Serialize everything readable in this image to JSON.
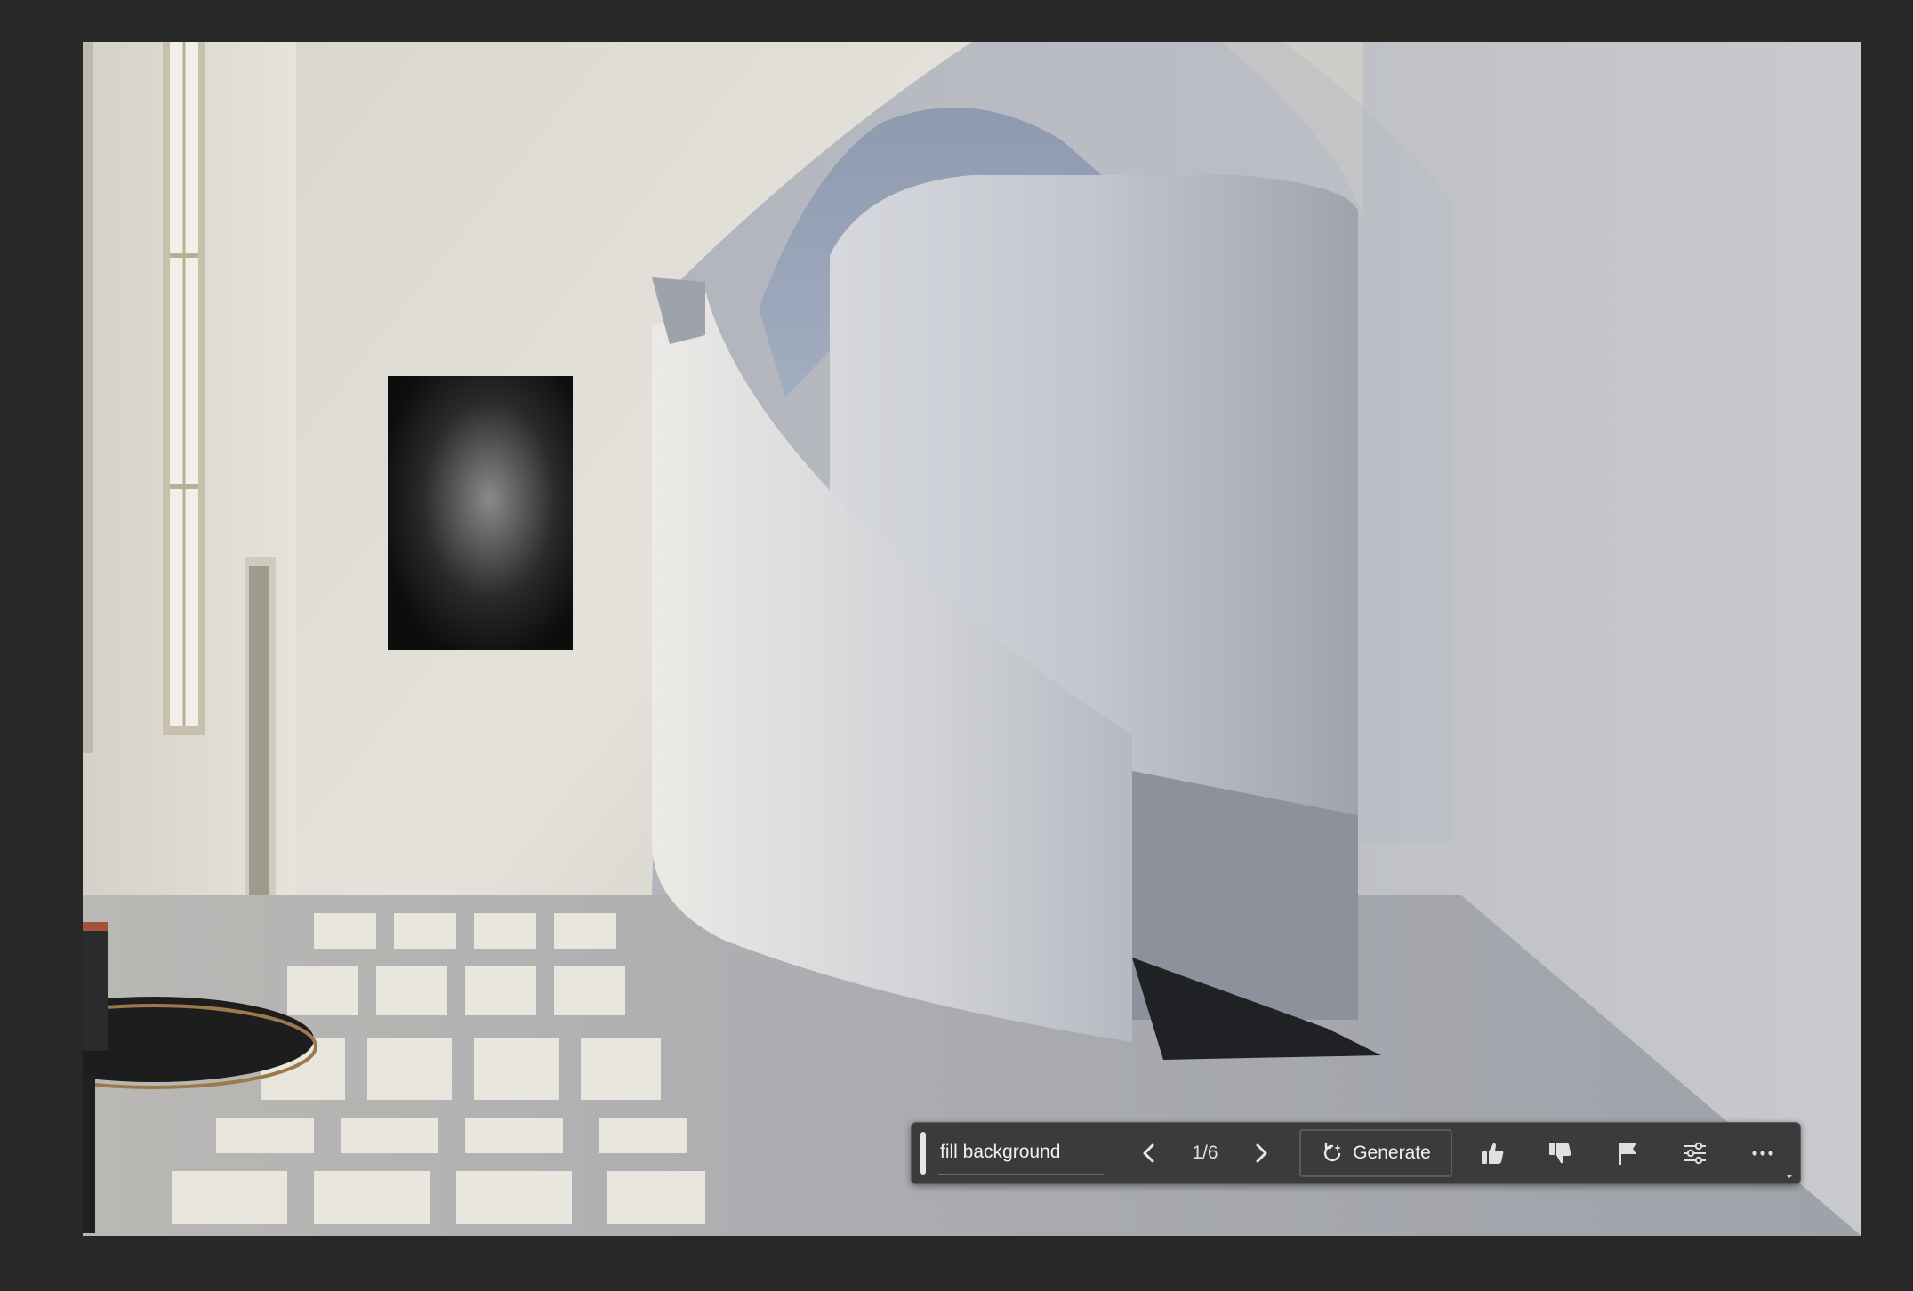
{
  "taskbar": {
    "prompt_value": "fill background",
    "counter": "1/6",
    "generate_label": "Generate",
    "icons": {
      "previous": "chevron-left-icon",
      "next": "chevron-right-icon",
      "generate": "refresh-sparkle-icon",
      "thumbs_up": "thumbs-up-icon",
      "thumbs_down": "thumbs-down-icon",
      "flag": "flag-icon",
      "settings": "sliders-icon",
      "more": "ellipsis-icon"
    }
  },
  "colors": {
    "app_background": "#282828",
    "taskbar_background": "#3b3b3b",
    "taskbar_border": "#5a5a5a",
    "text": "#f0f0f0"
  }
}
